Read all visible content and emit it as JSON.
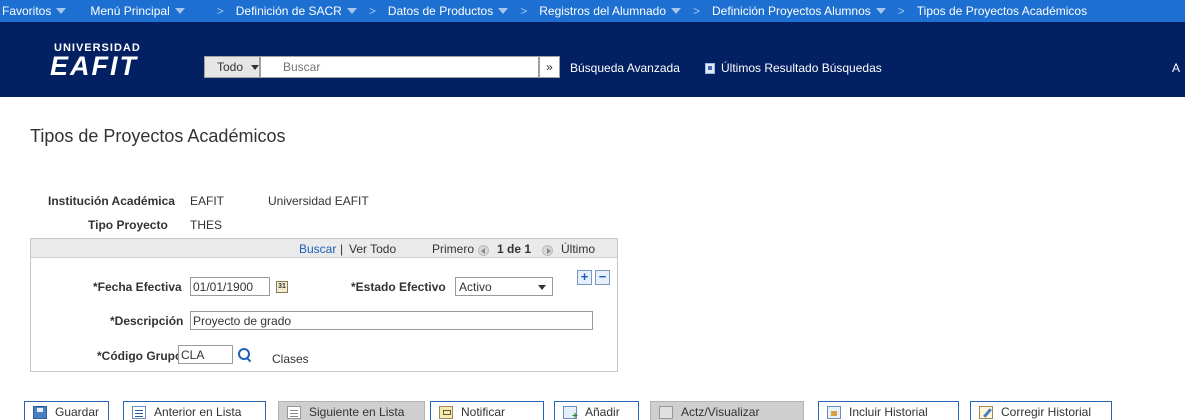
{
  "topnav": {
    "items": [
      {
        "label": "Favoritos",
        "dropdown": true
      },
      {
        "label": "Menú Principal",
        "dropdown": true
      },
      {
        "label": "Definición de SACR",
        "dropdown": true
      },
      {
        "label": "Datos de Productos",
        "dropdown": true
      },
      {
        "label": "Registros del Alumnado",
        "dropdown": true
      },
      {
        "label": "Definición Proyectos Alumnos",
        "dropdown": true
      },
      {
        "label": "Tipos de Proyectos Académicos",
        "dropdown": false
      }
    ],
    "separator": ">"
  },
  "header": {
    "logo_top": "UNIVERSIDAD",
    "logo_main": "EAFIT",
    "search_scope": "Todo",
    "search_placeholder": "Buscar",
    "search_go": "»",
    "advanced_search": "Búsqueda Avanzada",
    "last_results": "Últimos Resultado Búsquedas",
    "right_label": "A"
  },
  "page": {
    "title": "Tipos de Proyectos Académicos",
    "institution_label": "Institución Académica",
    "institution_code": "EAFIT",
    "institution_name": "Universidad EAFIT",
    "project_type_label": "Tipo Proyecto",
    "project_type_value": "THES"
  },
  "scroll": {
    "find": "Buscar",
    "divider": "|",
    "view_all": "Ver Todo",
    "first": "Primero",
    "count": "1 de 1",
    "last": "Último"
  },
  "form": {
    "effdt_label": "*Fecha Efectiva",
    "effdt_value": "01/01/1900",
    "calendar_glyph": "31",
    "status_label": "*Estado Efectivo",
    "status_value": "Activo",
    "descr_label": "*Descripción",
    "descr_value": "Proyecto de grado",
    "group_label": "*Código Grupo",
    "group_value": "CLA",
    "group_descr": "Clases",
    "add_row": "+",
    "delete_row": "−"
  },
  "toolbar": {
    "save": "Guardar",
    "previous": "Anterior en Lista",
    "next": "Siguiente en Lista",
    "notify": "Notificar",
    "add": "Añadir",
    "update_display": "Actz/Visualizar",
    "include_history": "Incluir Historial",
    "correct_history": "Corregir Historial"
  }
}
